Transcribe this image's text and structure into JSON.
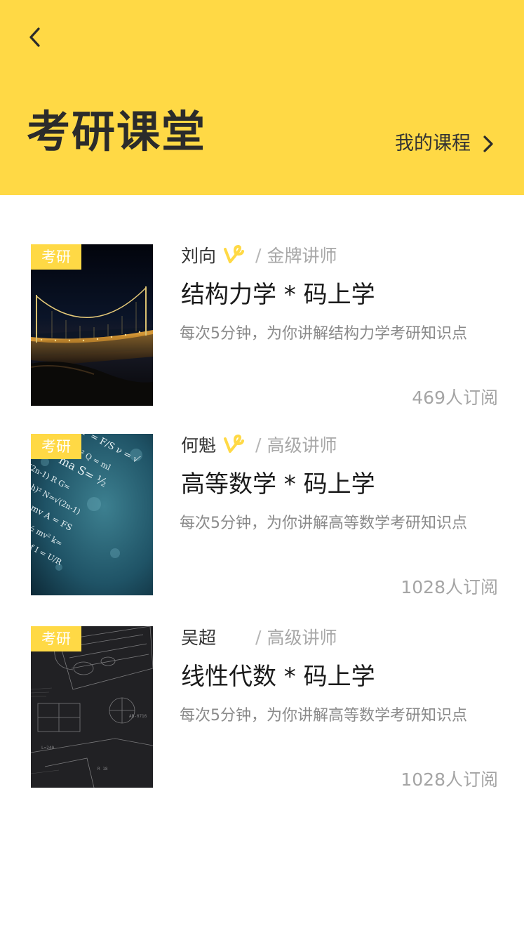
{
  "header": {
    "back_icon": "chevron-left-icon",
    "title": "考研课堂",
    "my_courses_label": "我的课程",
    "my_courses_icon": "chevron-right-icon",
    "background_color": "#FFD945"
  },
  "courses": [
    {
      "tag": "考研",
      "author": "刘向",
      "verified": true,
      "separator": "/",
      "author_title": "金牌讲师",
      "title": "结构力学 * 码上学",
      "description": "每次5分钟，为你讲解结构力学考研知识点",
      "subscribers": "469人订阅",
      "cover": "night-bridge-image"
    },
    {
      "tag": "考研",
      "author": "何魁",
      "verified": true,
      "separator": "/",
      "author_title": "高级讲师",
      "title": "高等数学 * 码上学",
      "description": "每次5分钟，为你讲解高等数学考研知识点",
      "subscribers": "1028人订阅",
      "cover": "physics-formulas-image"
    },
    {
      "tag": "考研",
      "author": "吴超",
      "verified": false,
      "separator": "/",
      "author_title": "高级讲师",
      "title": "线性代数 * 码上学",
      "description": "每次5分钟，为你讲解高等数学考研知识点",
      "subscribers": "1028人订阅",
      "cover": "blueprint-sketch-image"
    }
  ],
  "colors": {
    "accent": "#FFD945",
    "verified_badge": "#FFD945"
  }
}
